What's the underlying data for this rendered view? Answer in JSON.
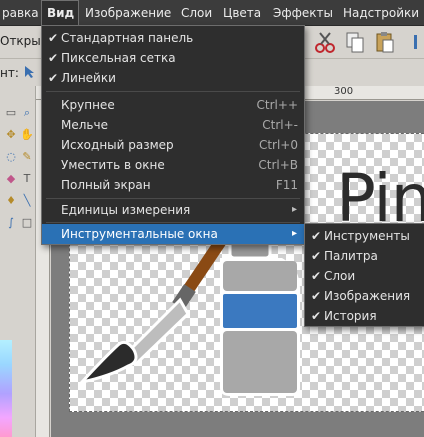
{
  "menubar": {
    "items": [
      {
        "label": "равка"
      },
      {
        "label": "Вид"
      },
      {
        "label": "Изображение"
      },
      {
        "label": "Слои"
      },
      {
        "label": "Цвета"
      },
      {
        "label": "Эффекты"
      },
      {
        "label": "Надстройки"
      }
    ]
  },
  "toolbar": {
    "open_label": "Откры",
    "tool_label": "нт:",
    "ruler_mark": "300"
  },
  "view_menu": {
    "items": [
      {
        "label": "Стандартная панель",
        "checked": "✔",
        "accel": ""
      },
      {
        "label": "Пиксельная сетка",
        "checked": "✔",
        "accel": ""
      },
      {
        "label": "Линейки",
        "checked": "✔",
        "accel": ""
      },
      {
        "label": "Крупнее",
        "checked": "",
        "accel": "Ctrl++"
      },
      {
        "label": "Мельче",
        "checked": "",
        "accel": "Ctrl+-"
      },
      {
        "label": "Исходный размер",
        "checked": "",
        "accel": "Ctrl+0"
      },
      {
        "label": "Уместить в окне",
        "checked": "",
        "accel": "Ctrl+B"
      },
      {
        "label": "Полный экран",
        "checked": "",
        "accel": "F11"
      },
      {
        "label": "Единицы измерения",
        "checked": "",
        "accel": ""
      },
      {
        "label": "Инструментальные окна",
        "checked": "",
        "accel": ""
      }
    ]
  },
  "tool_windows_submenu": {
    "items": [
      {
        "label": "Инструменты",
        "checked": "✔"
      },
      {
        "label": "Палитра",
        "checked": "✔"
      },
      {
        "label": "Слои",
        "checked": "✔"
      },
      {
        "label": "Изображения",
        "checked": "✔"
      },
      {
        "label": "История",
        "checked": "✔"
      }
    ]
  },
  "canvas": {
    "logo_text": "Pin"
  },
  "colors": {
    "menu_bg": "#2e2e2e",
    "highlight": "#2a71b5",
    "menubar_bg": "#3c3c3c"
  }
}
